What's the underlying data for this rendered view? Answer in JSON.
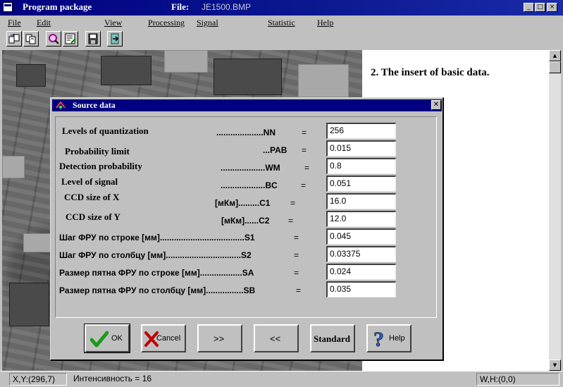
{
  "window": {
    "title": "Program package",
    "file_label": "File:",
    "file_name": "JE1500.BMP",
    "controls": [
      "_",
      "□",
      "×"
    ]
  },
  "menu": [
    "File",
    "Edit",
    "View",
    "Processing",
    "Signal",
    "Statistic",
    "Help"
  ],
  "toolbar": {
    "icons": [
      "open-icon",
      "copy-icon",
      "zoom-icon",
      "edit-sheet-icon",
      "save-icon",
      "exit-icon"
    ]
  },
  "panel": {
    "heading": "2. The insert of basic data."
  },
  "status": {
    "coords": "X,Y:(296,7)",
    "intensity": "Интенсивность = 16",
    "size": "W,H:(0,0)"
  },
  "dialog": {
    "title": "Source data",
    "fields": [
      {
        "label": "Levels of quantization",
        "dots": "....................NN",
        "eq": "=",
        "value": "256"
      },
      {
        "label": "Probability limit",
        "dots": "...PAB",
        "eq": "=",
        "value": "0.015"
      },
      {
        "label": "Detection probability",
        "dots": "...................WM",
        "eq": "=",
        "value": "0.8"
      },
      {
        "label": "Level  of signal",
        "dots": "...................BC",
        "eq": "=",
        "value": "0.051"
      },
      {
        "label": "CCD  size  of  X",
        "dots": "[мКм].........C1",
        "eq": "=",
        "value": "16.0"
      },
      {
        "label": "CCD  size  of  Y",
        "dots": "[мКм]......C2",
        "eq": "=",
        "value": "12.0"
      },
      {
        "label": "Шаг ФРУ по строке [мм]....................................S1",
        "eq": "=",
        "value": "0.045"
      },
      {
        "label": "Шаг ФРУ по столбцу [мм]................................S2",
        "eq": "=",
        "value": "0.03375"
      },
      {
        "label": "Размер пятна ФРУ по строке [мм]..................SA",
        "eq": "=",
        "value": "0.024"
      },
      {
        "label": "Размер пятна ФРУ по столбцу [мм]................SB",
        "eq": "=",
        "value": "0.035"
      }
    ],
    "buttons": {
      "ok": "OK",
      "cancel": "Cancel",
      "next": ">>",
      "prev": "<<",
      "standard": "Standard",
      "help": "Help"
    }
  },
  "colors": {
    "titlebar": "#000080",
    "face": "#c0c0c0",
    "ok_check": "#1a9a1a",
    "cancel_x": "#c00000",
    "help_q": "#2060c0"
  }
}
